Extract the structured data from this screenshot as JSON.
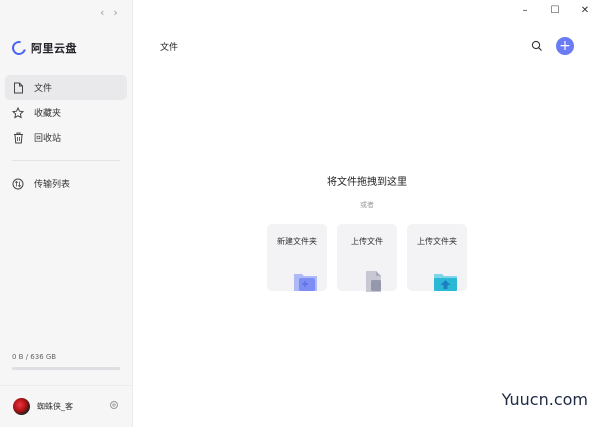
{
  "app": {
    "name": "阿里云盘"
  },
  "nav": {
    "back": "‹",
    "forward": "›"
  },
  "sidebar": {
    "items": [
      {
        "label": "文件",
        "icon": "file-icon",
        "active": true
      },
      {
        "label": "收藏夹",
        "icon": "star-icon",
        "active": false
      },
      {
        "label": "回收站",
        "icon": "trash-icon",
        "active": false
      }
    ],
    "transfer": {
      "label": "传输列表",
      "icon": "transfer-icon"
    }
  },
  "storage": {
    "text": "0 B / 636 GB",
    "used_fraction": 0.0
  },
  "user": {
    "name": "蜘蛛侠_客"
  },
  "window": {
    "minimize": "–",
    "maximize": "☐",
    "close": "✕"
  },
  "main": {
    "title": "文件",
    "drop_title": "将文件拖拽到这里",
    "drop_or": "或者",
    "cards": [
      {
        "label": "新建文件夹",
        "icon": "new-folder-icon"
      },
      {
        "label": "上传文件",
        "icon": "upload-file-icon"
      },
      {
        "label": "上传文件夹",
        "icon": "upload-folder-icon"
      }
    ]
  },
  "watermark": "Yuucn.com",
  "colors": {
    "accent": "#4a63f0",
    "add_button": "#6a7bf4",
    "folder_blue": "#8a9af6",
    "upload_teal": "#27b8d8"
  }
}
